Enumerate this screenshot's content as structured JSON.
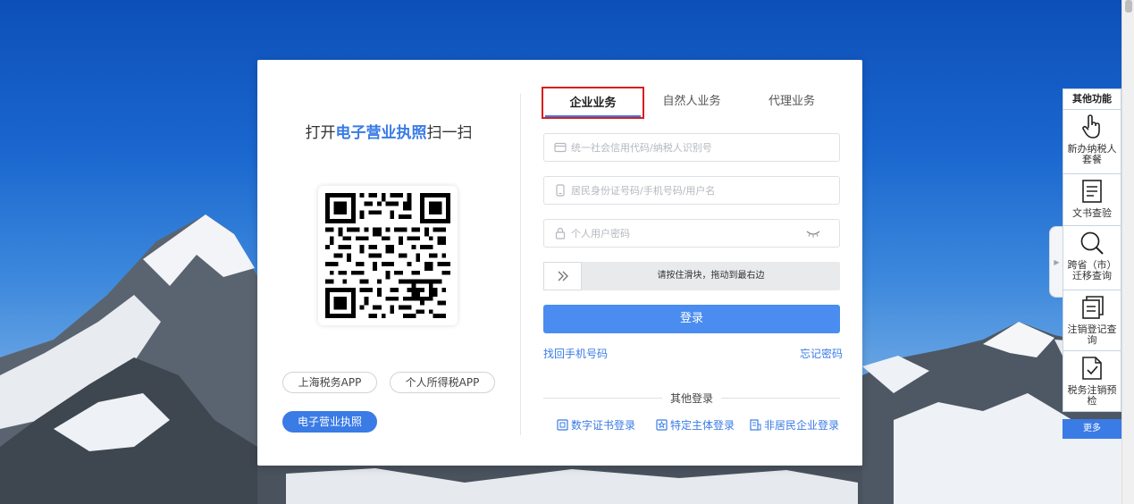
{
  "qr_section": {
    "title_prefix": "打开",
    "title_highlight": "电子营业执照",
    "title_suffix": "扫一扫",
    "app_buttons": [
      "上海税务APP",
      "个人所得税APP",
      "电子营业执照"
    ],
    "active_app": "电子营业执照"
  },
  "tabs": [
    {
      "label": "企业业务",
      "active": true
    },
    {
      "label": "自然人业务",
      "active": false
    },
    {
      "label": "代理业务",
      "active": false
    }
  ],
  "form": {
    "credit_code_placeholder": "统一社会信用代码/纳税人识别号",
    "id_placeholder": "居民身份证号码/手机号码/用户名",
    "password_placeholder": "个人用户密码",
    "slider_text": "请按住滑块，拖动到最右边",
    "login_label": "登录",
    "retrieve_phone_label": "找回手机号码",
    "forgot_password_label": "忘记密码"
  },
  "other_login": {
    "label": "其他登录",
    "options": [
      "数字证书登录",
      "特定主体登录",
      "非居民企业登录"
    ]
  },
  "side_panel": {
    "header": "其他功能",
    "items": [
      {
        "label": "新办纳税人套餐",
        "icon": "hand-pointer-icon"
      },
      {
        "label": "文书查验",
        "icon": "document-icon"
      },
      {
        "label": "跨省（市）迁移查询",
        "icon": "search-icon"
      },
      {
        "label": "注销登记查询",
        "icon": "clipboard-list-icon"
      },
      {
        "label": "税务注销预检",
        "icon": "document-check-icon"
      }
    ],
    "more_label": "更多"
  },
  "colors": {
    "accent": "#3a7be6",
    "button": "#4a8cf0",
    "tab_highlight_border": "#d81e1e"
  }
}
